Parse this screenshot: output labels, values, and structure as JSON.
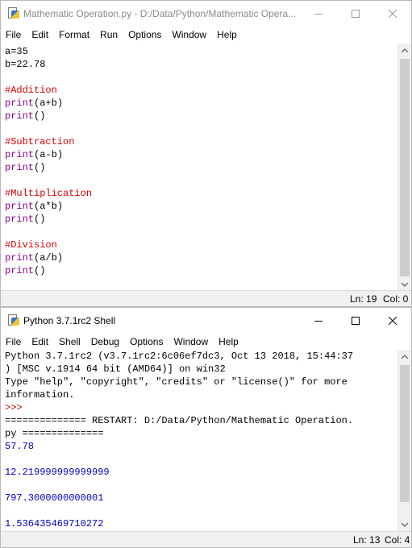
{
  "editor": {
    "title": "Mathematic Operation.py - D:/Data/Python/Mathematic Opera...",
    "menu": [
      "File",
      "Edit",
      "Format",
      "Run",
      "Options",
      "Window",
      "Help"
    ],
    "lines": [
      [
        {
          "t": "a=35",
          "c": "default"
        }
      ],
      [
        {
          "t": "b=22.78",
          "c": "default"
        }
      ],
      [],
      [
        {
          "t": "#Addition",
          "c": "comment"
        }
      ],
      [
        {
          "t": "print",
          "c": "builtin"
        },
        {
          "t": "(a+b)",
          "c": "default"
        }
      ],
      [
        {
          "t": "print",
          "c": "builtin"
        },
        {
          "t": "()",
          "c": "default"
        }
      ],
      [],
      [
        {
          "t": "#Subtraction",
          "c": "comment"
        }
      ],
      [
        {
          "t": "print",
          "c": "builtin"
        },
        {
          "t": "(a-b)",
          "c": "default"
        }
      ],
      [
        {
          "t": "print",
          "c": "builtin"
        },
        {
          "t": "()",
          "c": "default"
        }
      ],
      [],
      [
        {
          "t": "#Multiplication",
          "c": "comment"
        }
      ],
      [
        {
          "t": "print",
          "c": "builtin"
        },
        {
          "t": "(a*b)",
          "c": "default"
        }
      ],
      [
        {
          "t": "print",
          "c": "builtin"
        },
        {
          "t": "()",
          "c": "default"
        }
      ],
      [],
      [
        {
          "t": "#Division",
          "c": "comment"
        }
      ],
      [
        {
          "t": "print",
          "c": "builtin"
        },
        {
          "t": "(a/b)",
          "c": "default"
        }
      ],
      [
        {
          "t": "print",
          "c": "builtin"
        },
        {
          "t": "()",
          "c": "default"
        }
      ]
    ],
    "status": {
      "ln": "Ln: 19",
      "col": "Col: 0"
    }
  },
  "shell": {
    "title": "Python 3.7.1rc2 Shell",
    "menu": [
      "File",
      "Edit",
      "Shell",
      "Debug",
      "Options",
      "Window",
      "Help"
    ],
    "lines": [
      [
        {
          "t": "Python 3.7.1rc2 (v3.7.1rc2:6c06ef7dc3, Oct 13 2018, 15:44:37",
          "c": "default"
        }
      ],
      [
        {
          "t": ") [MSC v.1914 64 bit (AMD64)] on win32",
          "c": "default"
        }
      ],
      [
        {
          "t": "Type \"help\", \"copyright\", \"credits\" or \"license()\" for more",
          "c": "default"
        }
      ],
      [
        {
          "t": "information.",
          "c": "default"
        }
      ],
      [
        {
          "t": ">>> ",
          "c": "prompt"
        }
      ],
      [
        {
          "t": "============== RESTART: D:/Data/Python/Mathematic Operation.",
          "c": "default"
        }
      ],
      [
        {
          "t": "py ==============",
          "c": "default"
        }
      ],
      [
        {
          "t": "57.78",
          "c": "output"
        }
      ],
      [],
      [
        {
          "t": "12.219999999999999",
          "c": "output"
        }
      ],
      [],
      [
        {
          "t": "797.3000000000001",
          "c": "output"
        }
      ],
      [],
      [
        {
          "t": "1.536435469710272",
          "c": "output"
        }
      ]
    ],
    "status": {
      "ln": "Ln: 13",
      "col": "Col: 4"
    }
  },
  "colors": {
    "comment": "#dd0000",
    "builtin": "#900090",
    "output": "#0000c0",
    "prompt": "#c00000"
  }
}
